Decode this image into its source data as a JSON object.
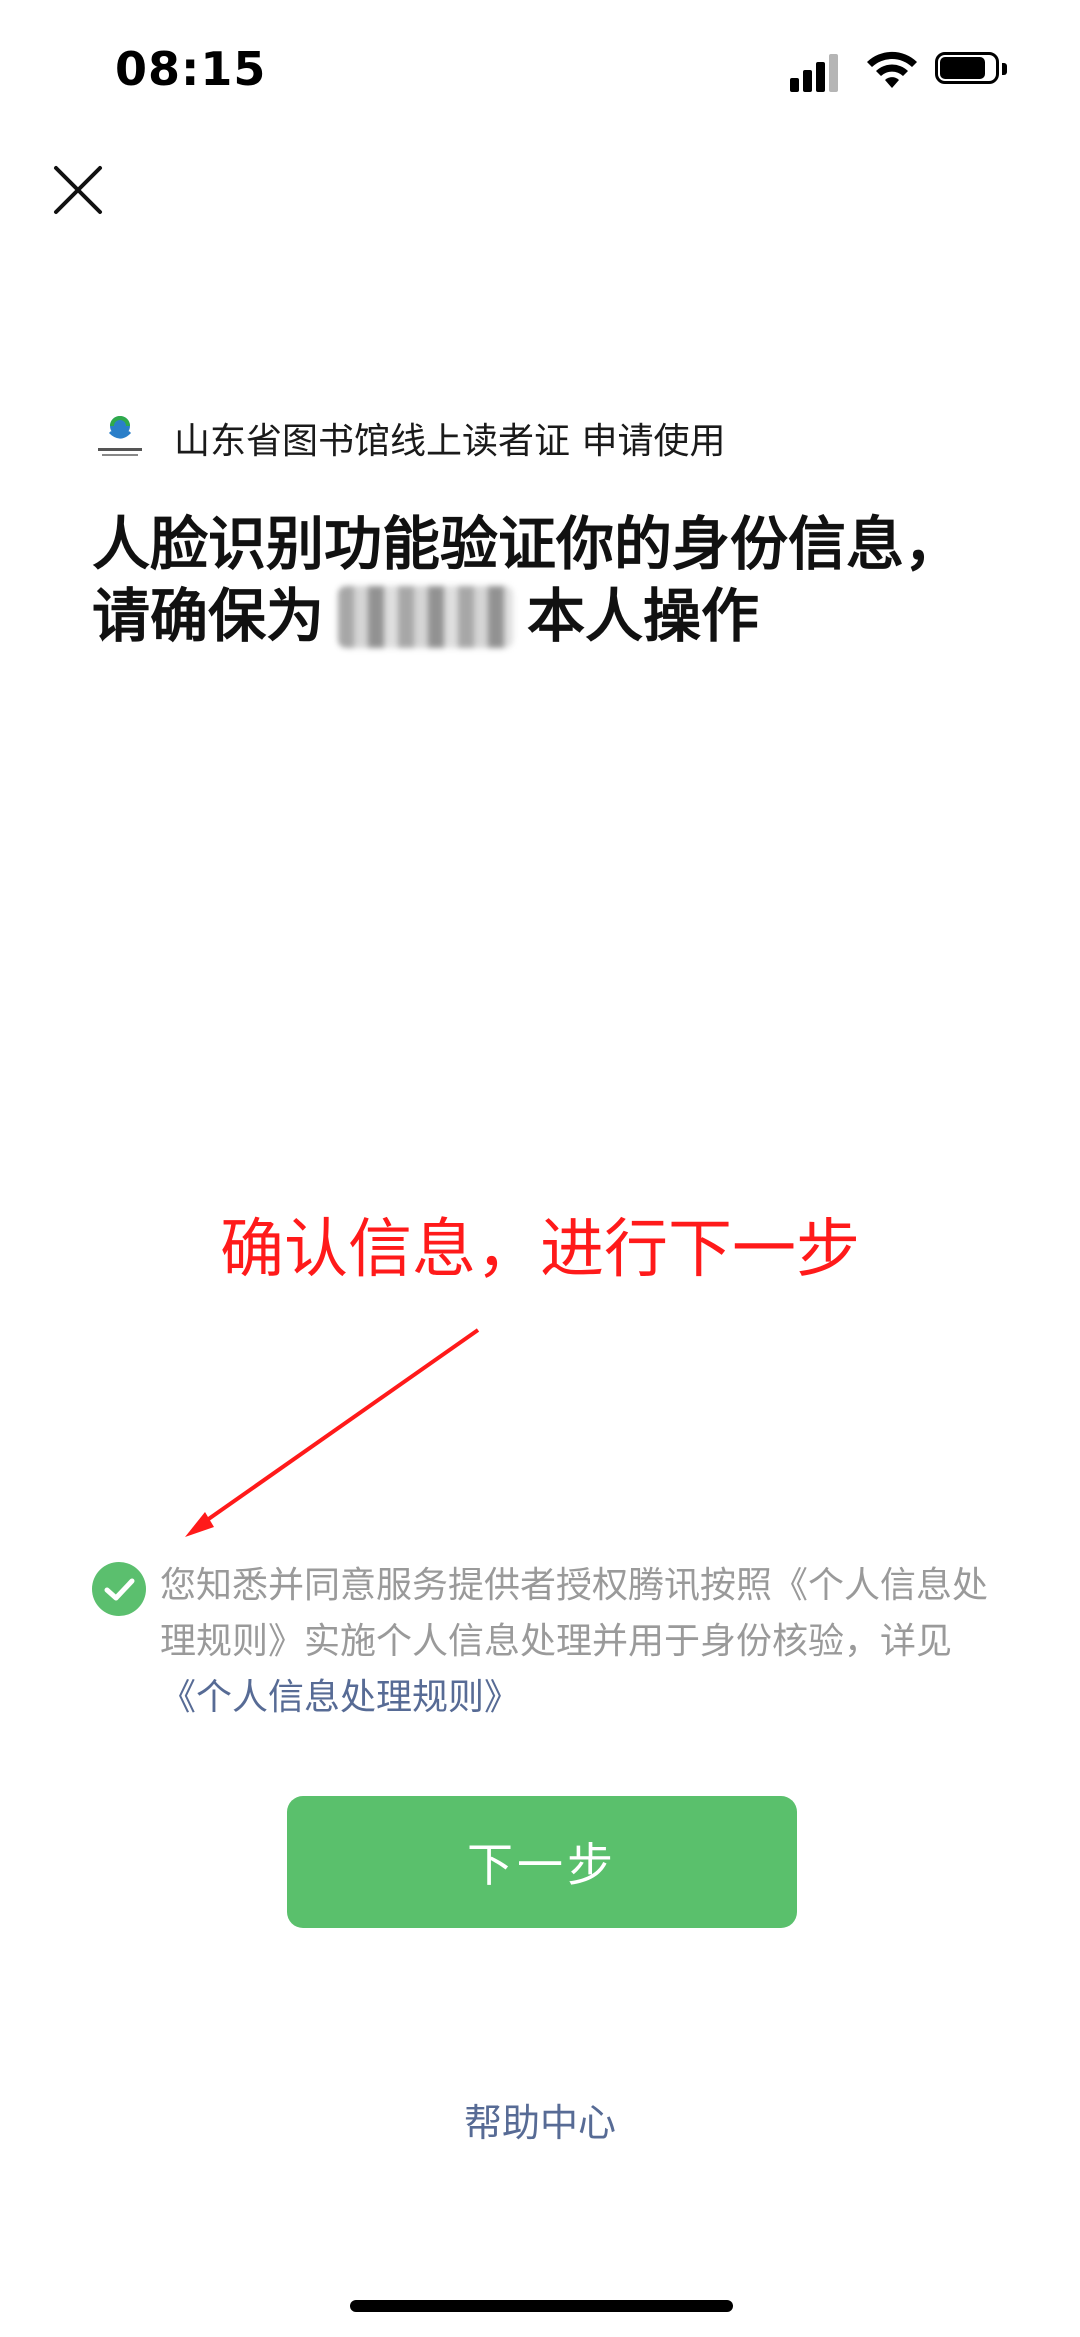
{
  "status_bar": {
    "time": "08:15"
  },
  "app": {
    "name": "山东省图书馆线上读者证 申请使用"
  },
  "title": {
    "part1": "人脸识别功能验证你的身份信息，请确保为",
    "part2": "本人操作"
  },
  "annotation": {
    "text": "确认信息，进行下一步",
    "color": "#ff1a1a"
  },
  "consent": {
    "text": "您知悉并同意服务提供者授权腾讯按照《个人信息处理规则》实施个人信息处理并用于身份核验，详见",
    "link": "《个人信息处理规则》"
  },
  "buttons": {
    "next": "下一步",
    "help": "帮助中心"
  },
  "colors": {
    "accent_green": "#5ac06c",
    "link_blue": "#576b95"
  },
  "icons": [
    "close-icon",
    "check-icon",
    "signal-icon",
    "wifi-icon",
    "battery-icon",
    "library-logo"
  ]
}
